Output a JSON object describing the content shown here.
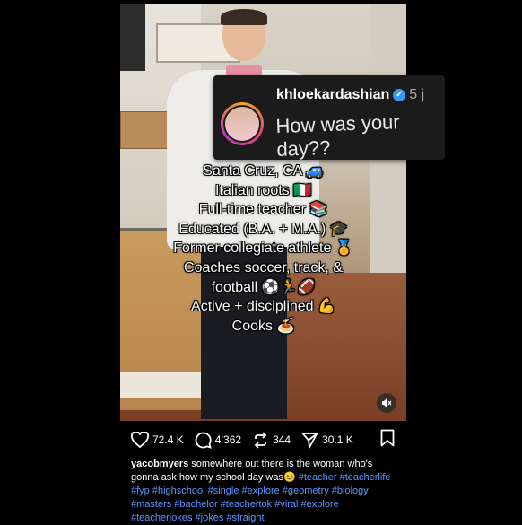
{
  "comment": {
    "username": "khloekardashian",
    "age": "5 j",
    "text": "How was your day??"
  },
  "caption_lines": [
    "Santa Cruz, CA 🚙",
    "Italian roots 🇮🇹",
    "Full-time teacher 📚",
    "Educated (B.A. + M.A.) 🎓",
    "Former collegiate athlete 🏅",
    "Coaches soccer, track, &",
    "football ⚽🏃🏈",
    "Active + disciplined 💪",
    "Cooks 🍝"
  ],
  "actions": {
    "likes": "72.4 K",
    "comments": "4’362",
    "reposts": "344",
    "shares": "30.1 K"
  },
  "post": {
    "username": "yacobmyers",
    "text": " somewhere out there is the woman who's gonna ask how my school day was😊 ",
    "hashtags": "#teacher #teacherlife #fyp #highschool #single #explore #geometry #biology #masters #bachelor #teachertok #viral #explore #teacherjokes #jokes #straight"
  },
  "icons": [
    "heart-icon",
    "comment-icon",
    "repost-icon",
    "share-icon",
    "bookmark-icon",
    "mute-icon",
    "verified-icon"
  ]
}
